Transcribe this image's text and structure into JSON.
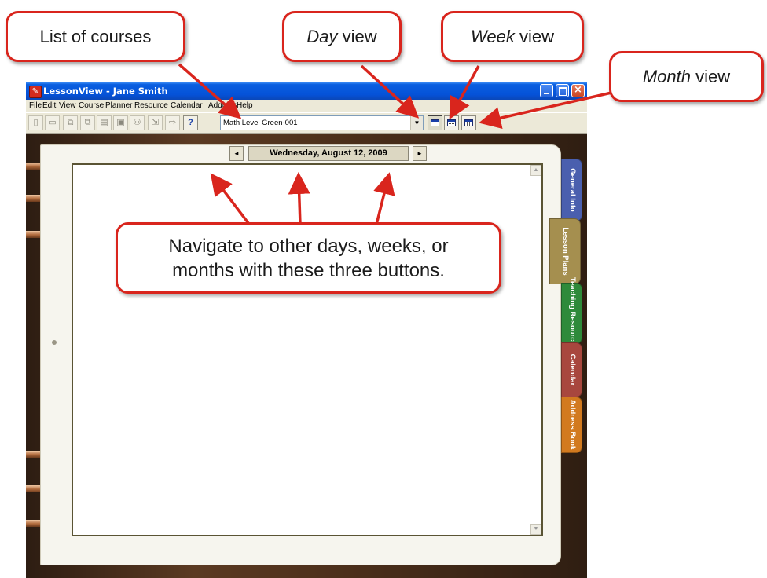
{
  "window": {
    "title": "LessonView - Jane Smith",
    "app_icon": "lessonview-app-icon"
  },
  "menubar": {
    "items": [
      "File",
      "Edit",
      "View",
      "Course",
      "Planner",
      "Resource",
      "Calendar",
      "Address",
      "Help"
    ]
  },
  "toolbar": {
    "buttons": [
      {
        "icon": "new-document-icon",
        "glyph": "▯"
      },
      {
        "icon": "open-folder-icon",
        "glyph": "▭"
      },
      {
        "icon": "copy-icon",
        "glyph": "⧉"
      },
      {
        "icon": "paste-icon",
        "glyph": "⧉"
      },
      {
        "icon": "print-icon",
        "glyph": "▤"
      },
      {
        "icon": "print-preview-icon",
        "glyph": "▣"
      },
      {
        "icon": "find-binoculars-icon",
        "glyph": "⚇"
      },
      {
        "icon": "export-icon",
        "glyph": "⇲"
      },
      {
        "icon": "forward-arrow-icon",
        "glyph": "⇨"
      },
      {
        "icon": "help-icon",
        "glyph": "?"
      }
    ],
    "course_select": {
      "value": "Math Level Green-001",
      "arrow": "▼"
    },
    "view_buttons": [
      "day-view",
      "week-view",
      "month-view"
    ]
  },
  "planner": {
    "date": "Wednesday, August 12, 2009",
    "prev_glyph": "◄",
    "next_glyph": "►",
    "scroll_up_glyph": "▲",
    "scroll_down_glyph": "▼"
  },
  "tabs": [
    {
      "label": "General Info",
      "color": "#4a5fae"
    },
    {
      "label": "Lesson Plans",
      "color": "#a58f4f"
    },
    {
      "label": "Teaching Resources",
      "color": "#2e8a3a"
    },
    {
      "label": "Calendar",
      "color": "#a8473e"
    },
    {
      "label": "Address Book",
      "color": "#d27a1f"
    }
  ],
  "callouts": {
    "list_of_courses": "List of courses",
    "day_view": {
      "em": "Day",
      "rest": " view"
    },
    "week_view": {
      "em": "Week",
      "rest": " view"
    },
    "month_view": {
      "em": "Month",
      "rest": " view"
    },
    "navigate_line1": "Navigate to other days, weeks, or",
    "navigate_line2": "months with these three buttons."
  },
  "colors": {
    "callout_border": "#d9251d",
    "title_bar": "#0552d8"
  }
}
